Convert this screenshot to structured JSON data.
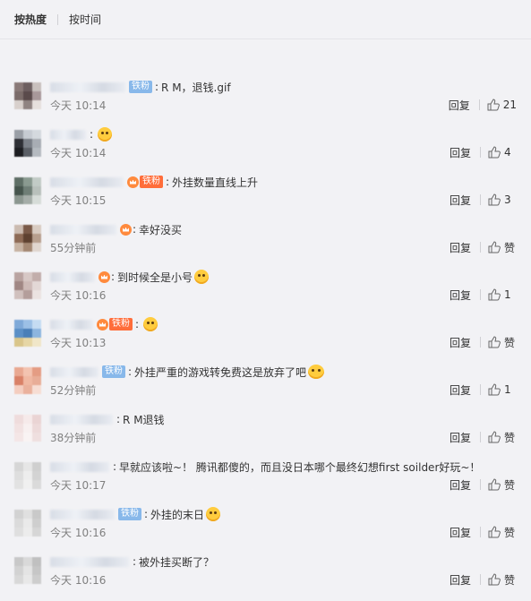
{
  "sort": {
    "hot": "按热度",
    "time": "按时间"
  },
  "colors": {
    "background": "#f2f2f5",
    "badge_blue": "#88b8ea",
    "badge_orange": "#ff6d3a",
    "meta_gray": "#808080"
  },
  "comments": [
    {
      "badge": "铁粉",
      "text": "R  M，退钱.gif",
      "time": "今天 10:14",
      "reply": "回复",
      "likes": "21"
    },
    {
      "badge": "",
      "text": "",
      "time": "今天 10:14",
      "reply": "回复",
      "likes": "4",
      "emoji": "grinning-face"
    },
    {
      "badge": "铁粉",
      "text": "外挂数量直线上升",
      "time": "今天 10:15",
      "reply": "回复",
      "likes": "3"
    },
    {
      "badge": "",
      "text": "幸好没买",
      "time": "55分钟前",
      "reply": "回复",
      "likes": "赞"
    },
    {
      "badge": "",
      "text": "到时候全是小号",
      "time": "今天 10:16",
      "reply": "回复",
      "likes": "1",
      "emoji": "thinking-face"
    },
    {
      "badge": "铁粉",
      "text": "",
      "time": "今天 10:13",
      "reply": "回复",
      "likes": "赞",
      "emoji": "crying-face"
    },
    {
      "badge": "铁粉",
      "text": "外挂严重的游戏转免费这是放弃了吧",
      "time": "52分钟前",
      "reply": "回复",
      "likes": "1",
      "emoji": "laughing-face"
    },
    {
      "badge": "",
      "text": "R  M退钱",
      "time": "38分钟前",
      "reply": "回复",
      "likes": "赞"
    },
    {
      "badge": "",
      "text": "早就应该啦~！ 腾讯都傻的，而且没日本哪个最终幻想first soilder好玩~！",
      "time": "今天 10:17",
      "reply": "回复",
      "likes": "赞"
    },
    {
      "badge": "铁粉",
      "text": "外挂的末日",
      "time": "今天 10:16",
      "reply": "回复",
      "likes": "赞",
      "emoji": "cat-face"
    },
    {
      "badge": "",
      "text": "被外挂买断了？",
      "time": "今天 10:16",
      "reply": "回复",
      "likes": "赞"
    }
  ]
}
